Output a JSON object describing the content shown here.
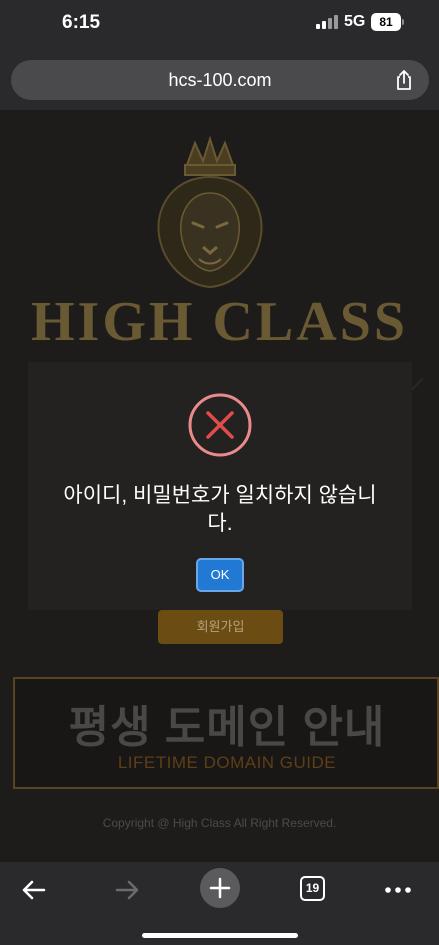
{
  "status_bar": {
    "time": "6:15",
    "network": "5G",
    "battery": "81"
  },
  "browser": {
    "url": "hcs-100.com",
    "tabs_count": "19"
  },
  "site": {
    "brand": "HIGH CLASS",
    "signup_label": "회원가입",
    "domain_banner_title": "평생 도메인 안내",
    "domain_banner_subtitle": "LIFETIME DOMAIN GUIDE",
    "copyright": "Copyright @ High Class All Right Reserved."
  },
  "alert": {
    "message": "아이디, 비밀번호가 일치하지 않습니다.",
    "ok_label": "OK",
    "icon": "error-x-icon"
  },
  "colors": {
    "accent_error": "#e24b4b",
    "ok_button": "#2179d4",
    "gold": "#6a5a34"
  }
}
